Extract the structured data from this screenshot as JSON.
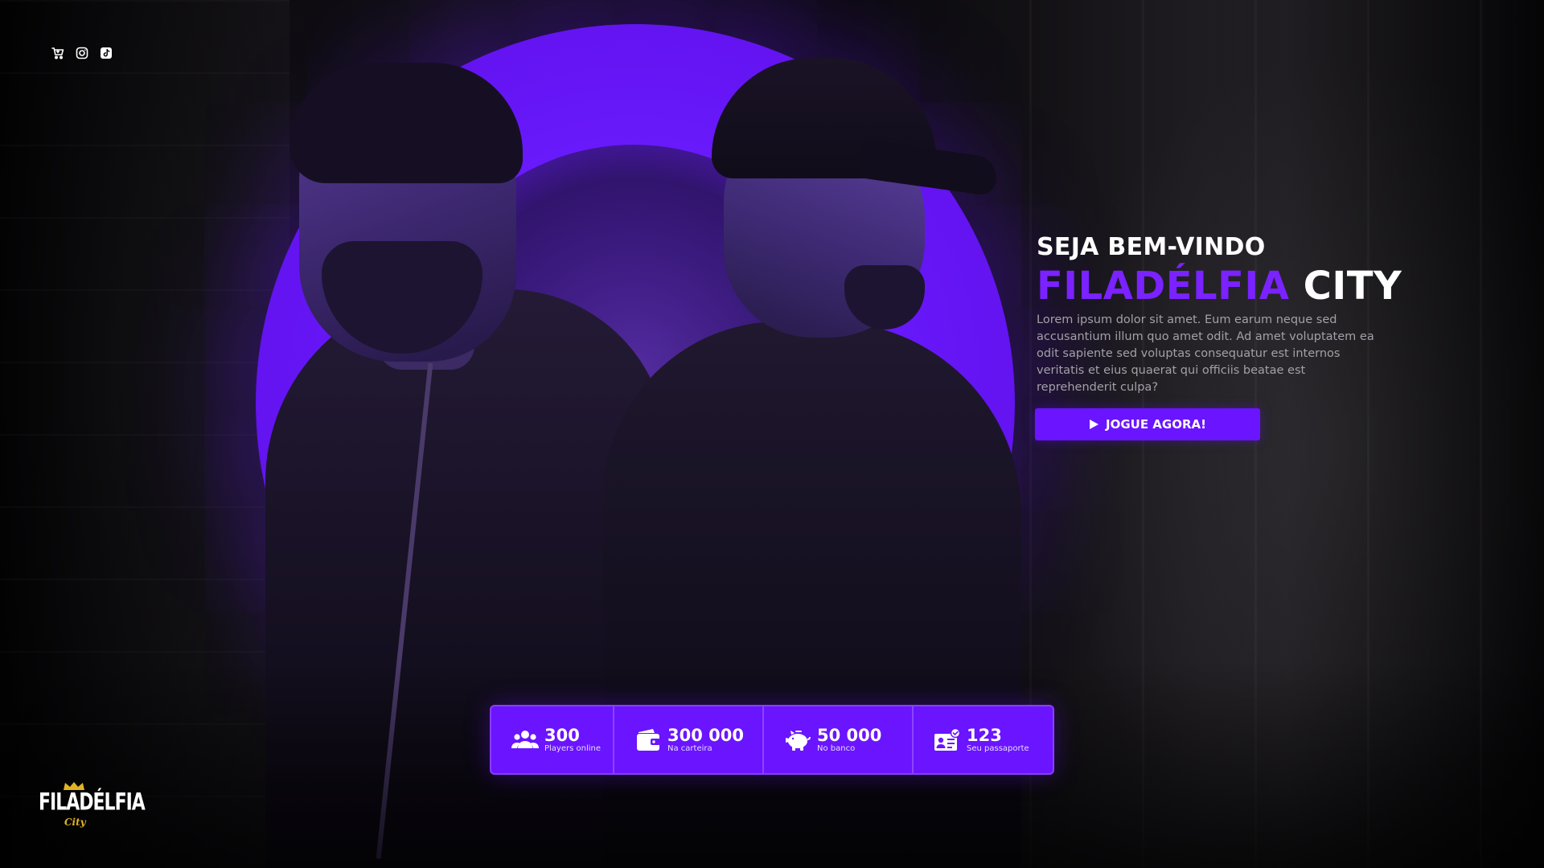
{
  "socials": {
    "items": [
      {
        "icon": "cart-icon",
        "name": "social-cart"
      },
      {
        "icon": "instagram-icon",
        "name": "social-instagram"
      },
      {
        "icon": "tiktok-icon",
        "name": "social-tiktok"
      }
    ]
  },
  "hero": {
    "welcome": "SEJA BEM-VINDO",
    "title_accent": "FILADÉLFIA",
    "title_rest": " CITY",
    "description": "Lorem ipsum dolor sit amet. Eum earum neque sed accusantium illum quo amet odit. Ad amet voluptatem ea odit sapiente sed voluptas consequatur est internos veritatis et eius quaerat qui officiis beatae est reprehenderit culpa?",
    "cta_label": "JOGUE AGORA!",
    "cta_icon": "play-icon"
  },
  "stats": [
    {
      "icon": "users-icon",
      "value": "300",
      "label": "Players online"
    },
    {
      "icon": "wallet-icon",
      "value": "300 000",
      "label": "Na carteira"
    },
    {
      "icon": "piggy-bank-icon",
      "value": "50 000",
      "label": "No banco"
    },
    {
      "icon": "passport-id-icon",
      "value": "123",
      "label": "Seu passaporte"
    }
  ],
  "logo": {
    "word": "FILADÉLFIA",
    "sub": "City"
  },
  "colors": {
    "accent": "#6a14ff",
    "accent_text": "#7a22ff",
    "background": "#050407",
    "logo_gold": "#e0b325"
  }
}
